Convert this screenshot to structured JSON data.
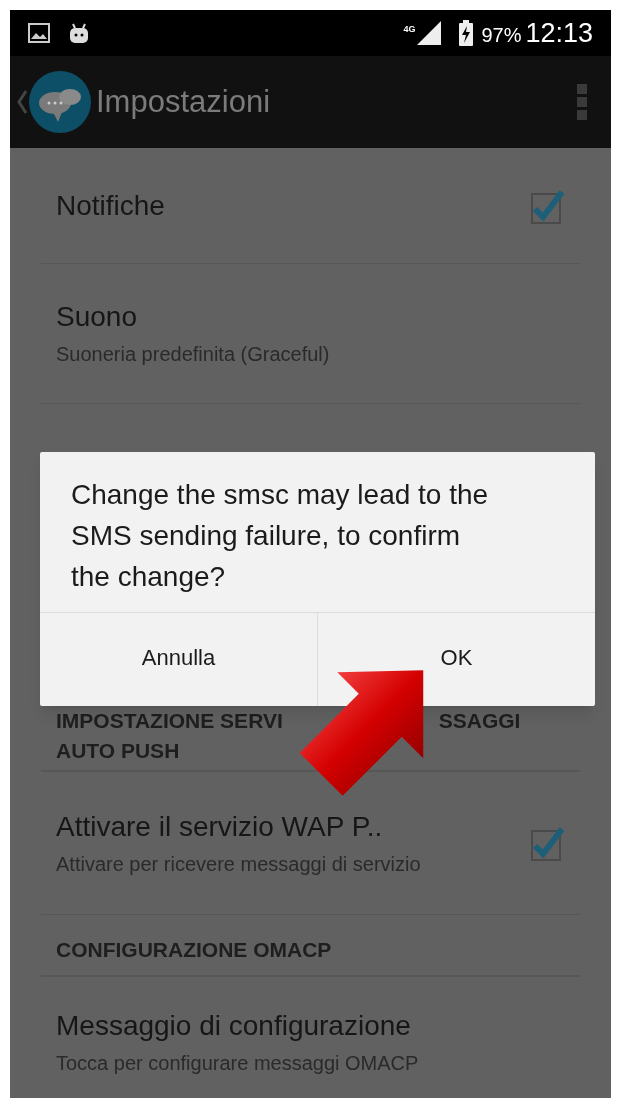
{
  "status_bar": {
    "network": "4G",
    "battery": "97%",
    "time": "12:13"
  },
  "app_bar": {
    "title": "Impostazioni"
  },
  "settings": [
    {
      "kind": "checkbox",
      "title": "Notifiche",
      "checked": true
    },
    {
      "kind": "pref",
      "title": "Suono",
      "summary": "Suoneria predefinita (Graceful)"
    },
    {
      "kind": "hidden"
    },
    {
      "kind": "header",
      "lines": [
        [
          "IMPOSTAZIONE SERVI",
          "SSAGGI"
        ],
        [
          "AUTO PUSH"
        ]
      ]
    },
    {
      "kind": "checkbox",
      "title": "Attivare il servizio WAP P..",
      "summary": "Attivare per ricevere messaggi di servizio",
      "checked": true
    },
    {
      "kind": "header",
      "lines": [
        [
          "CONFIGURAZIONE OMACP"
        ]
      ]
    },
    {
      "kind": "pref",
      "title": "Messaggio di configurazione",
      "summary": "Tocca per configurare messaggi OMACP"
    }
  ],
  "dialog": {
    "message": "Change the smsc may lead to the SMS sending failure, to confirm the change?",
    "buttons": [
      "Annulla",
      "OK"
    ]
  }
}
